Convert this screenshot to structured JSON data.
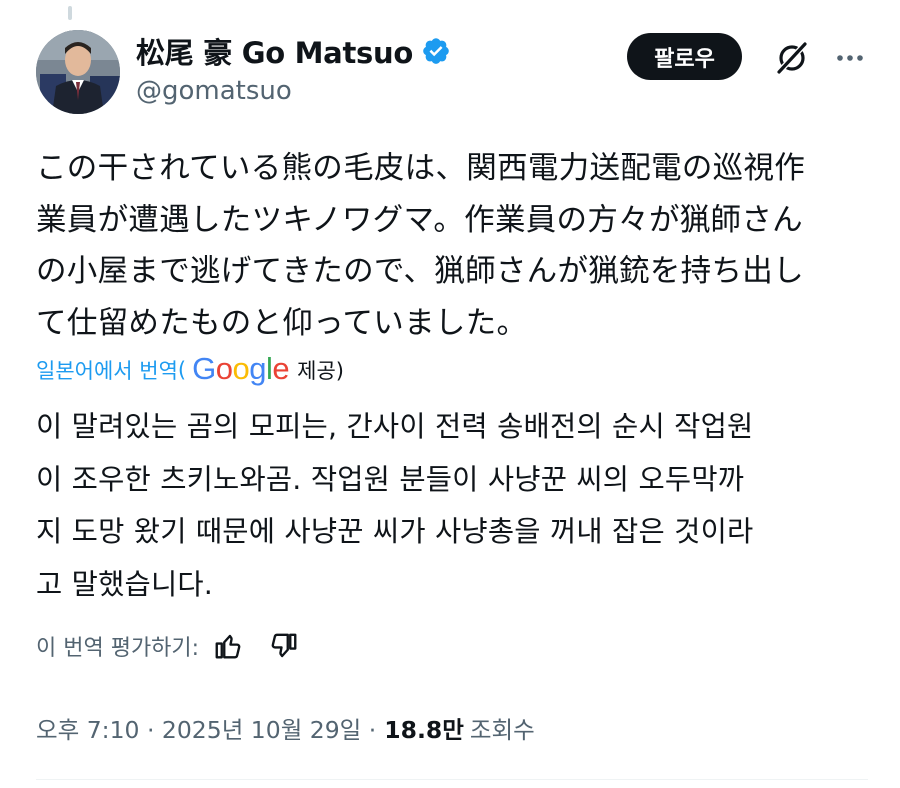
{
  "author": {
    "display_name": "松尾 豪 Go Matsuo",
    "handle": "@gomatsuo",
    "verified": true
  },
  "actions": {
    "follow_label": "팔로우",
    "grok_icon": "grok-icon",
    "more_icon": "more-icon"
  },
  "tweet": {
    "text": "この干されている熊の毛皮は、関西電力送配電の巡視作\n業員が遭遇したツキノワグマ。作業員の方々が猟師さん\nの小屋まで逃げてきたので、猟師さんが猟銃を持ち出し\nて仕留めたものと仰っていました。"
  },
  "translation": {
    "link_label": "일본어에서 번역",
    "paren_open": "(",
    "provider": "Google",
    "provided_label": "제공)",
    "text": "이 말려있는 곰의 모피는, 간사이 전력 송배전의 순시 작업원\n이 조우한 츠키노와곰. 작업원 분들이 사냥꾼 씨의 오두막까\n지 도망 왔기 때문에 사냥꾼 씨가 사냥총을 꺼내 잡은 것이라\n고 말했습니다.",
    "rate_label": "이 번역 평가하기:"
  },
  "meta": {
    "time": "오후 7:10 · 2025년 10월 29일 ·",
    "views": "18.8만",
    "views_label": "조회수"
  },
  "colors": {
    "accent": "#1d9bf0",
    "text": "#0f1419",
    "secondary": "#536471",
    "google_blue": "#4285F4",
    "google_red": "#EA4335",
    "google_yellow": "#FBBC05",
    "google_green": "#34A853"
  }
}
